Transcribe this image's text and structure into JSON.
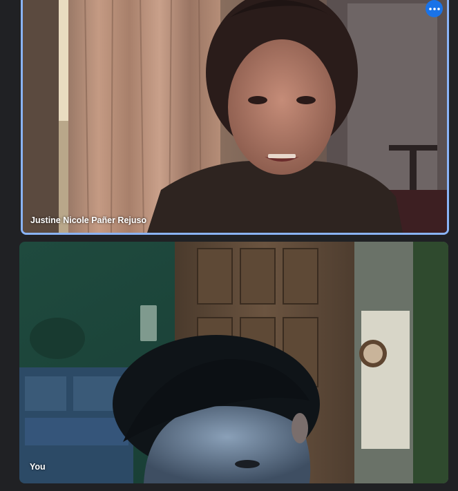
{
  "participants": [
    {
      "name": "Justine Nicole Pañer Rejuso",
      "speaking": true
    },
    {
      "name": "You",
      "speaking": false
    }
  ],
  "more_options": {
    "icon": "more-horiz-icon"
  },
  "colors": {
    "background": "#202124",
    "active_speaker_border": "#8ab4f8",
    "more_button": "#1a73e8"
  }
}
